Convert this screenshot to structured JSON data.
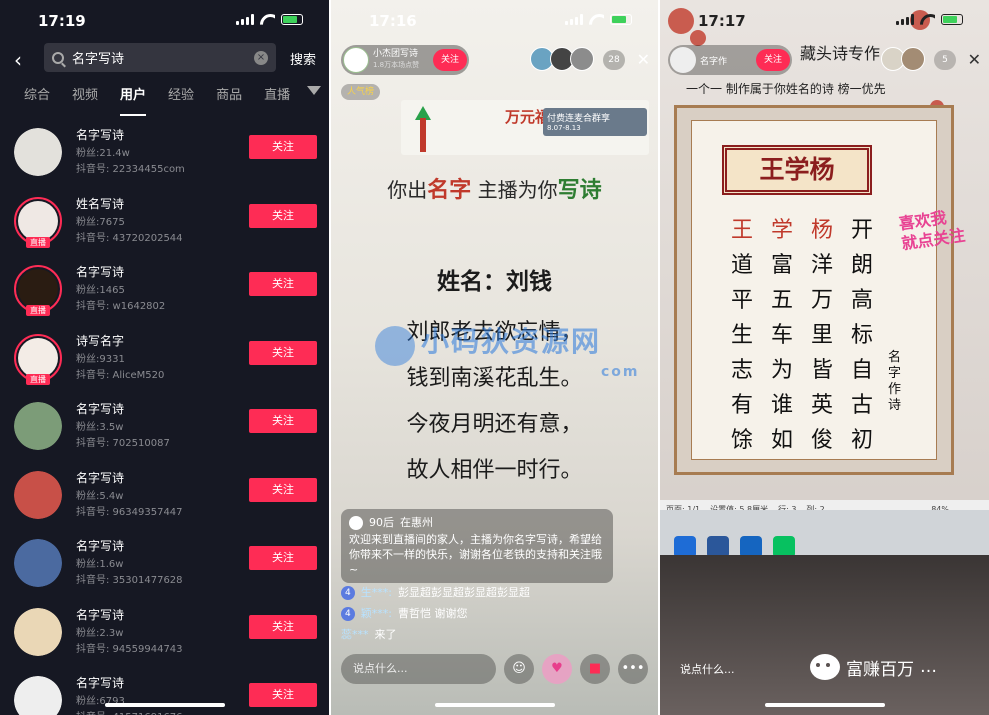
{
  "panel1": {
    "status": {
      "time": "17:19"
    },
    "search": {
      "value": "名字写诗",
      "button": "搜索"
    },
    "tabs": [
      "综合",
      "视频",
      "用户",
      "经验",
      "商品",
      "直播"
    ],
    "active_tab": "用户",
    "live_tag": "直播",
    "follow_label": "关注",
    "users": [
      {
        "name": "名字写诗",
        "fans": "粉丝:21.4w",
        "id": "抖音号: 22334455com",
        "live": false,
        "color": "#e3e1dc"
      },
      {
        "name": "姓名写诗",
        "fans": "粉丝:7675",
        "id": "抖音号: 43720202544",
        "live": true,
        "color": "#efe8e4"
      },
      {
        "name": "名字写诗",
        "fans": "粉丝:1465",
        "id": "抖音号: w1642802",
        "live": true,
        "color": "#2a1c12"
      },
      {
        "name": "诗写名字",
        "fans": "粉丝:9331",
        "id": "抖音号: AliceM520",
        "live": true,
        "color": "#f3ece6"
      },
      {
        "name": "名字写诗",
        "fans": "粉丝:3.5w",
        "id": "抖音号: 702510087",
        "live": false,
        "color": "#7c9c78"
      },
      {
        "name": "名字写诗",
        "fans": "粉丝:5.4w",
        "id": "抖音号: 96349357447",
        "live": false,
        "color": "#c85048"
      },
      {
        "name": "名字写诗",
        "fans": "粉丝:1.6w",
        "id": "抖音号: 35301477628",
        "live": false,
        "color": "#4b6aa0"
      },
      {
        "name": "名字写诗",
        "fans": "粉丝:2.3w",
        "id": "抖音号: 94559944743",
        "live": false,
        "color": "#ead7b6"
      },
      {
        "name": "名字写诗",
        "fans": "粉丝:6793",
        "id": "抖音号: 41571691676",
        "live": false,
        "color": "#eeeeee"
      }
    ]
  },
  "panel2": {
    "status": {
      "time": "17:16"
    },
    "host": {
      "name": "小杰团写诗",
      "likes": "1.8万本场点赞",
      "follow": "关注"
    },
    "viewer_count": "28",
    "rank": "人气榜",
    "banner": {
      "text": "万元福利",
      "ad_title": "付费连麦合群享",
      "ad_sub": "8.07-8.13"
    },
    "headline": {
      "a": "你出",
      "b": "名字",
      "c": " 主播为你",
      "d": "写诗"
    },
    "poem": {
      "name": "姓名：刘钱",
      "lines": [
        "刘郎老去欲忘情，",
        "钱到南溪花乱生。",
        "今夜月明还有意，",
        "故人相伴一时行。"
      ]
    },
    "watermark": {
      "text": "小码狄资源网",
      "sub": "com"
    },
    "chat": {
      "badge": "90后",
      "location": "在惠州",
      "message": "欢迎来到直播间的家人，主播为你名字写诗，希望给你带来不一样的快乐，谢谢各位老铁的支持和关注哦~"
    },
    "messages": [
      {
        "level": "4",
        "user": "生***:",
        "text": "彭显超彭显超彭显超彭显超"
      },
      {
        "level": "4",
        "user": "颖***:",
        "text": "曹哲恺  谢谢您"
      },
      {
        "level": "",
        "user": "蕊***",
        "text": "来了"
      }
    ],
    "input_placeholder": "说点什么..."
  },
  "panel3": {
    "status": {
      "time": "17:17"
    },
    "host": {
      "name": "名字作",
      "follow": "关注"
    },
    "title": "藏头诗专作",
    "subtitle": "一个一 制作属于你姓名的诗   榜一优先",
    "viewer_count": "5",
    "name_plaque": "王学杨",
    "poem_grid": [
      "王",
      "学",
      "杨",
      "开",
      "道",
      "富",
      "洋",
      "朗",
      "平",
      "五",
      "万",
      "高",
      "生",
      "车",
      "里",
      "标",
      "志",
      "为",
      "皆",
      "自",
      "有",
      "谁",
      "英",
      "古",
      "馀",
      "如",
      "俊",
      "初"
    ],
    "signature": "名字作诗",
    "sticker": {
      "line1": "喜欢我",
      "line2": "就点关注"
    },
    "editor_status": {
      "page": "页面: 1/1",
      "setting": "设置值: 5.8厘米",
      "row": "行: 3",
      "col": "列: 2",
      "zoom": "84%"
    },
    "input_placeholder": "说点什么...",
    "wechat_brand": "富赚百万"
  }
}
